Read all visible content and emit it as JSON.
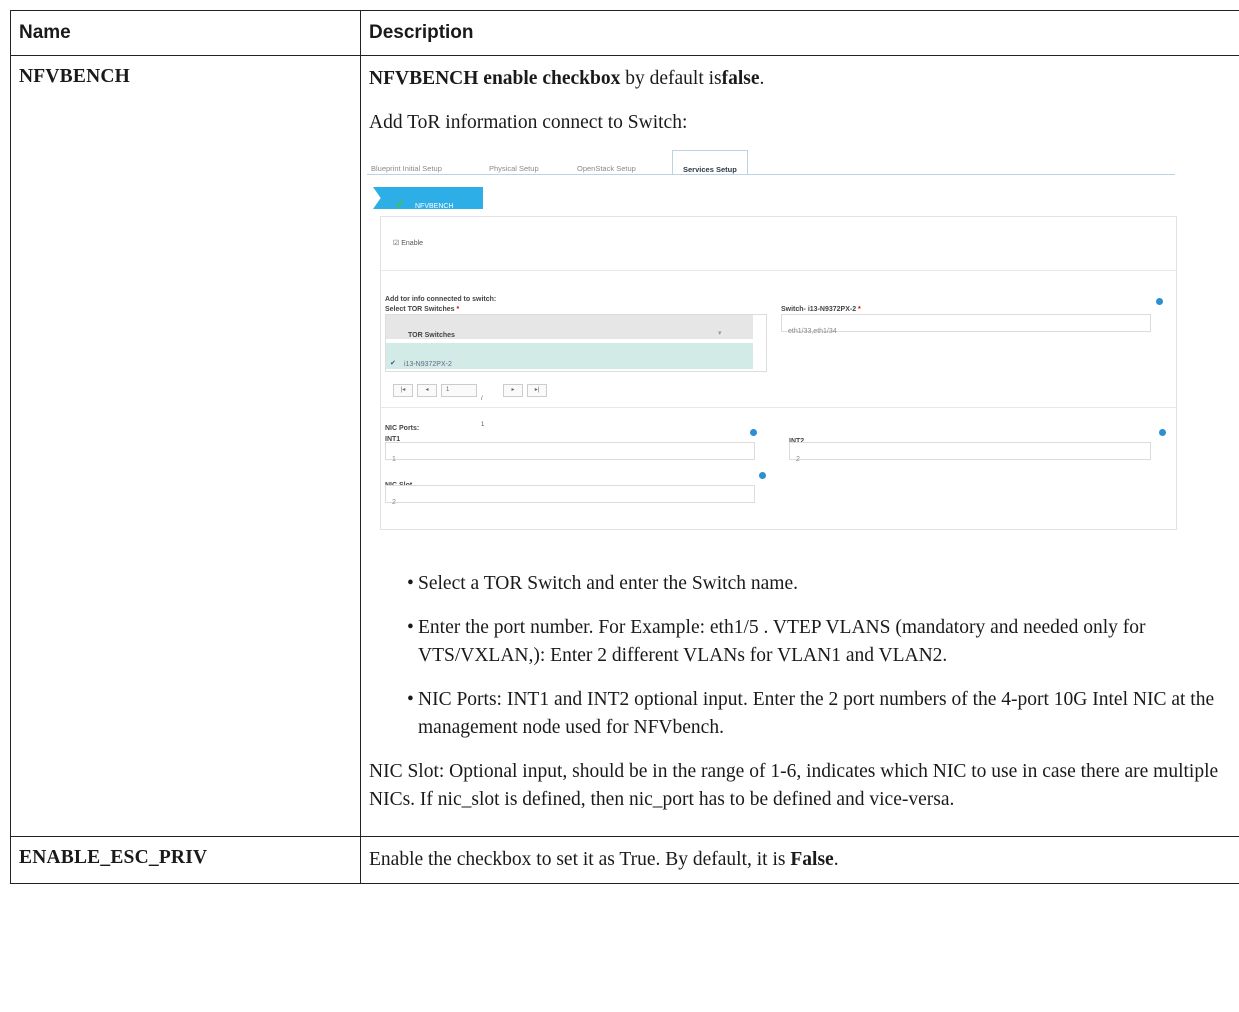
{
  "table": {
    "headers": {
      "name": "Name",
      "description": "Description"
    },
    "row1": {
      "name": "NFVBENCH",
      "p1_bold": "NFVBENCH enable checkbox",
      "p1_text": " by default is",
      "p1_bold2": "false",
      "p1_end": ".",
      "p2": "Add ToR information connect to Switch:",
      "bullets": [
        "Select a TOR Switch and enter the Switch name.",
        "Enter the port number. For Example: eth1/5 . VTEP VLANS (mandatory and needed only for VTS/VXLAN,): Enter 2 different VLANs for VLAN1 and VLAN2.",
        "NIC Ports: INT1 and INT2 optional input. Enter the 2 port numbers of the 4-port 10G Intel NIC at the management node used for NFVbench."
      ],
      "continuation": "NIC Slot: Optional input, should be in the range of 1-6, indicates which NIC to use in case there are multiple NICs. If nic_slot is defined, then nic_port has to be defined and vice-versa."
    },
    "row2": {
      "name": "ENABLE_ESC_PRIV",
      "text": "Enable the checkbox to set it as True. By default, it is ",
      "bold": "False",
      "end": "."
    }
  },
  "screenshot": {
    "tabs": [
      "Blueprint Initial Setup",
      "Physical Setup",
      "OpenStack Setup",
      "Services Setup"
    ],
    "active_tab": "Services Setup",
    "badge_label": "NFVBENCH",
    "enable_label": "Enable",
    "add_tor_label": "Add tor info connected to switch:",
    "select_tor_label": "Select TOR Switches",
    "required_mark": "*",
    "switch_label": "Switch- i13-N9372PX-2",
    "switch_value": "eth1/33,eth1/34",
    "grid_header": "TOR Switches",
    "grid_row": "i13-N9372PX-2",
    "pager_page": "1",
    "pager_of": "/ 1",
    "nic_ports_label": "NIC Ports:",
    "int1_label": "INT1",
    "int1_value": "1",
    "int2_label": "INT2",
    "int2_value": "2",
    "nic_slot_label": "NIC Slot",
    "nic_slot_value": "2",
    "accent_color": "#2eaee6"
  }
}
